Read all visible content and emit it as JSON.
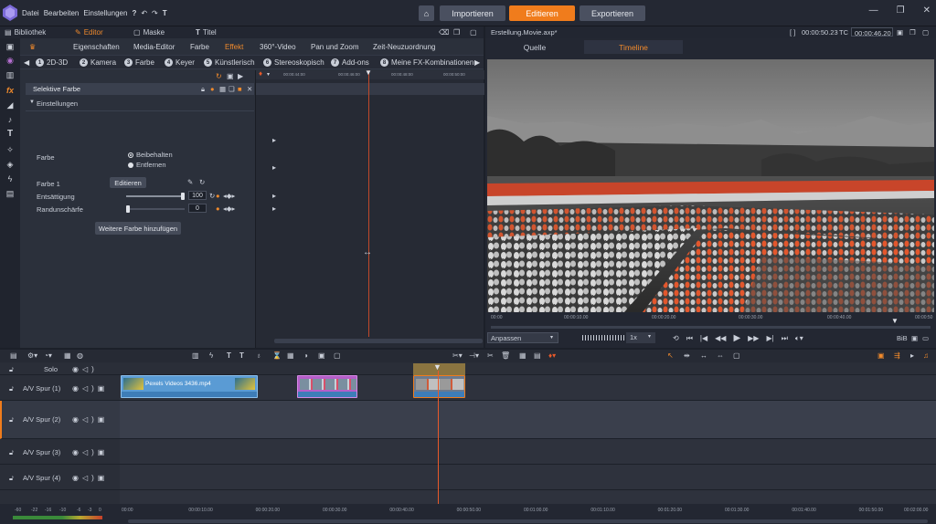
{
  "menu": [
    "Datei",
    "Bearbeiten",
    "Einstellungen"
  ],
  "nav_buttons": [
    {
      "label": "Importieren",
      "active": false
    },
    {
      "label": "Editieren",
      "active": true
    },
    {
      "label": "Exportieren",
      "active": false
    }
  ],
  "panel_tabs": [
    "Bibliothek",
    "Editor",
    "Maske",
    "Titel"
  ],
  "categories": [
    "Eigenschaften",
    "Media-Editor",
    "Farbe",
    "Effekt",
    "360°-Video",
    "Pan und Zoom",
    "Zeit-Neuzuordnung"
  ],
  "active_category": "Effekt",
  "subcategories": [
    {
      "num": "1",
      "label": "2D-3D"
    },
    {
      "num": "2",
      "label": "Kamera"
    },
    {
      "num": "3",
      "label": "Farbe"
    },
    {
      "num": "4",
      "label": "Keyer"
    },
    {
      "num": "5",
      "label": "Künstlerisch"
    },
    {
      "num": "6",
      "label": "Stereoskopisch"
    },
    {
      "num": "7",
      "label": "Add-ons"
    },
    {
      "num": "8",
      "label": "Meine FX-Kombinationen"
    }
  ],
  "effect": {
    "name": "Selektive Farbe",
    "section": "Einstellungen",
    "farbe_label": "Farbe",
    "radio_options": [
      "Beibehalten",
      "Entfernen"
    ],
    "farbe1_label": "Farbe 1",
    "edit_button": "Editieren",
    "entsaettigung_label": "Entsättigung",
    "entsaettigung_value": "100",
    "entsaettigung_level": 1.0,
    "randunschaerfe_label": "Randunschärfe",
    "randunschaerfe_value": "0",
    "randunschaerfe_level": 0.0,
    "add_color_button": "Weitere Farbe hinzufügen"
  },
  "mini_ruler": [
    "00:00:44:00",
    "00:00:46:00",
    "00:00:48:00",
    "00:00:50:00"
  ],
  "preview": {
    "project": "Erstellung.Movie.axp*",
    "tc_left": "00:00:50.23",
    "tc_label": "TC",
    "tc_right": "00:00:46.20",
    "tabs": [
      "Quelle",
      "Timeline"
    ],
    "active_tab": "Timeline",
    "ruler": [
      "00:00",
      "00:00:10.00",
      "00:00:20.00",
      "00:00:30.00",
      "00:00:40.00",
      "00:00:50"
    ],
    "fit_label": "Anpassen",
    "speed_label": "1x",
    "bib_label": "BiB"
  },
  "timeline": {
    "solo_label": "Solo",
    "tracks": [
      "A/V Spur (1)",
      "A/V Spur (2)",
      "A/V Spur (3)",
      "A/V Spur (4)"
    ],
    "clip1_label": "Pexels Videos 3436.mp4",
    "ruler": [
      "00:00",
      "00:00:10.00",
      "00:00:20.00",
      "00:00:30.00",
      "00:00:40.00",
      "00:00:50.00",
      "00:01:00.00",
      "00:01:10.00",
      "00:01:20.00",
      "00:01:30.00",
      "00:01:40.00",
      "00:01:50.00",
      "00:02:00.00"
    ],
    "meter_labels": [
      "-60",
      "-22",
      "-16",
      "-10",
      "-6",
      "-3",
      "0"
    ]
  },
  "colors": {
    "accent": "#f07c1c",
    "clip_blue": "#5a9bd4",
    "clip_purple": "#b55ec9",
    "playhead": "#e85a2a"
  }
}
